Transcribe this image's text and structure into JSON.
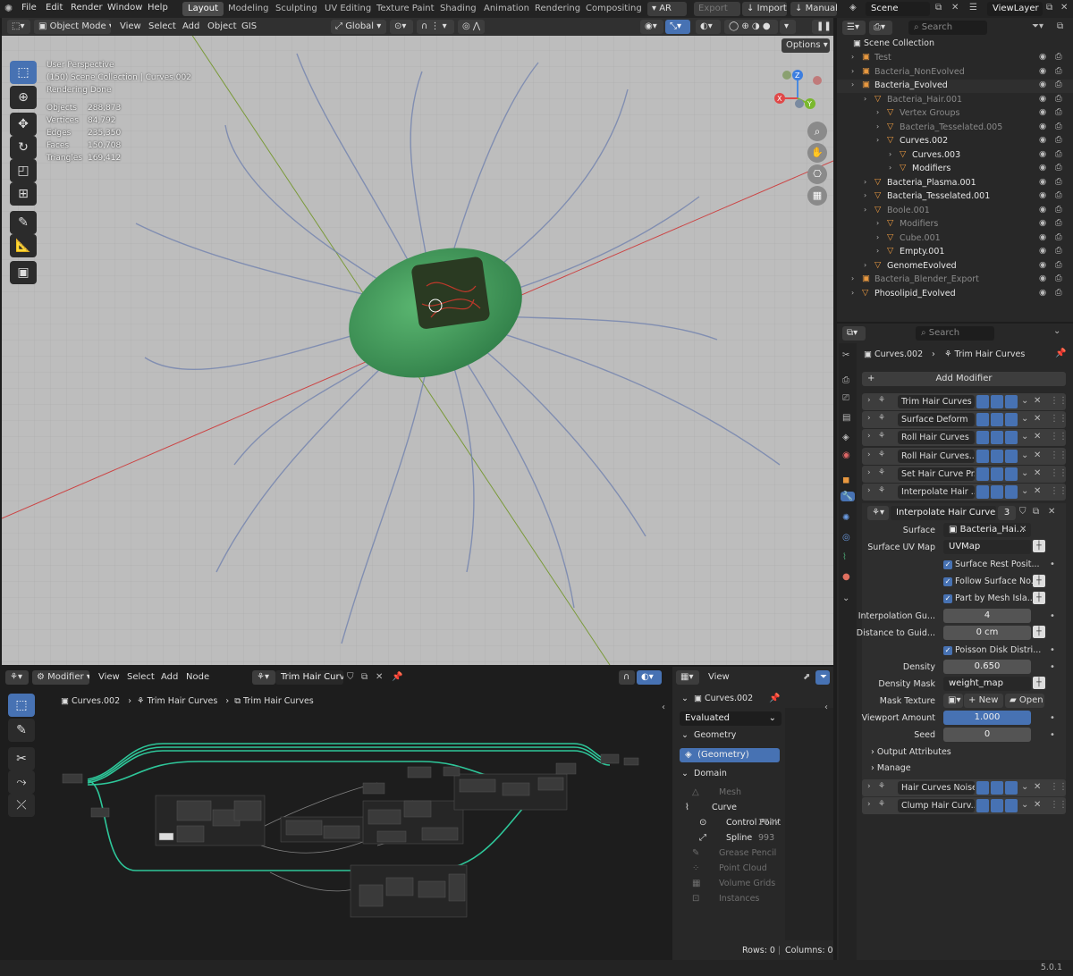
{
  "menubar": {
    "items": [
      "File",
      "Edit",
      "Render",
      "Window",
      "Help"
    ]
  },
  "workspaces": [
    "Layout",
    "Modeling",
    "Sculpting",
    "UV Editing",
    "Texture Paint",
    "Shading",
    "Animation",
    "Rendering",
    "Compositing"
  ],
  "topright": {
    "ar": "AR",
    "export": "Export",
    "import": "Import",
    "manual": "Manual",
    "scene": "Scene",
    "viewlayer": "ViewLayer"
  },
  "viewport": {
    "mode": "Object Mode",
    "menus": [
      "View",
      "Select",
      "Add",
      "Object",
      "GIS"
    ],
    "orientation": "Global",
    "options": "Options",
    "overlay_title": "User Perspective",
    "overlay_path": "(150) Scene Collection | Curves.002",
    "overlay_status": "Rendering Done",
    "stats": [
      {
        "label": "Objects",
        "value": "288,873"
      },
      {
        "label": "Vertices",
        "value": "84,792"
      },
      {
        "label": "Edges",
        "value": "235,350"
      },
      {
        "label": "Faces",
        "value": "150,708"
      },
      {
        "label": "Triangles",
        "value": "169,412"
      }
    ]
  },
  "outliner": {
    "search_placeholder": "Search",
    "root": "Scene Collection",
    "rows": [
      {
        "name": "Test",
        "indent": 1
      },
      {
        "name": "Bacteria_NonEvolved",
        "indent": 1
      },
      {
        "name": "Bacteria_Evolved",
        "indent": 1
      },
      {
        "name": "Bacteria_Hair.001",
        "indent": 2
      },
      {
        "name": "Vertex Groups",
        "indent": 3
      },
      {
        "name": "Bacteria_Tesselated.005",
        "indent": 3
      },
      {
        "name": "Curves.002",
        "indent": 3
      },
      {
        "name": "Curves.003",
        "indent": 4
      },
      {
        "name": "Modifiers",
        "indent": 4
      },
      {
        "name": "Bacteria_Plasma.001",
        "indent": 2
      },
      {
        "name": "Bacteria_Tesselated.001",
        "indent": 2
      },
      {
        "name": "Boole.001",
        "indent": 2
      },
      {
        "name": "Modifiers",
        "indent": 3
      },
      {
        "name": "Cube.001",
        "indent": 3
      },
      {
        "name": "Empty.001",
        "indent": 3
      },
      {
        "name": "GenomeEvolved",
        "indent": 2
      },
      {
        "name": "Bacteria_Blender_Export",
        "indent": 1
      },
      {
        "name": "Phosolipid_Evolved",
        "indent": 1
      }
    ]
  },
  "properties": {
    "search_placeholder": "Search",
    "breadcrumb_object": "Curves.002",
    "breadcrumb_modifier": "Trim Hair Curves",
    "add_modifier": "Add Modifier",
    "modifiers": [
      "Trim Hair Curves",
      "Surface Deform",
      "Roll Hair Curves",
      "Roll Hair Curves....",
      "Set Hair Curve Pr...",
      "Interpolate Hair ..."
    ],
    "nodegroup_name": "Interpolate Hair Curves",
    "nodegroup_users": "3",
    "fields": {
      "surface_label": "Surface",
      "surface_value": "Bacteria_Hai...",
      "uvmap_label": "Surface UV Map",
      "uvmap_value": "UVMap",
      "rest_pos": "Surface Rest Posit...",
      "follow_normal": "Follow Surface No...",
      "part_by_island": "Part by Mesh Isla...",
      "interp_label": "Interpolation Gu...",
      "interp_value": "4",
      "dist_label": "Distance to Guid...",
      "dist_value": "0 cm",
      "poisson": "Poisson Disk Distri...",
      "density_label": "Density",
      "density_value": "0.650",
      "density_mask_label": "Density Mask",
      "density_mask_value": "weight_map",
      "mask_tex_label": "Mask Texture",
      "mask_new": "New",
      "mask_open": "Open",
      "viewport_amount_label": "Viewport Amount",
      "viewport_amount_value": "1.000",
      "seed_label": "Seed",
      "seed_value": "0",
      "output_attributes": "Output Attributes",
      "manage": "Manage"
    },
    "modifiers_after": [
      "Hair Curves Noise",
      "Clump Hair Curv..."
    ]
  },
  "node_editor": {
    "type": "Modifier",
    "menus": [
      "View",
      "Select",
      "Add",
      "Node"
    ],
    "nodegroup": "Trim Hair Curves",
    "breadcrumb": [
      "Curves.002",
      "Trim Hair Curves",
      "Trim Hair Curves"
    ]
  },
  "spreadsheet": {
    "view": "View",
    "object": "Curves.002",
    "evaluated": "Evaluated",
    "geometry_header": "Geometry",
    "geometry_item": "(Geometry)",
    "domain_header": "Domain",
    "domains": [
      {
        "name": "Mesh",
        "count": ""
      },
      {
        "name": "Curve",
        "count": ""
      },
      {
        "name": "Control Point",
        "count": "274K"
      },
      {
        "name": "Spline",
        "count": "993"
      },
      {
        "name": "Grease Pencil",
        "count": ""
      },
      {
        "name": "Point Cloud",
        "count": ""
      },
      {
        "name": "Volume Grids",
        "count": ""
      },
      {
        "name": "Instances",
        "count": ""
      }
    ],
    "rows": "Rows: 0",
    "columns": "Columns: 0"
  },
  "status": {
    "version": "5.0.1"
  },
  "colors": {
    "accent": "#4772b3",
    "wire": "#2ec79a",
    "cell": "#3e9a5a"
  }
}
